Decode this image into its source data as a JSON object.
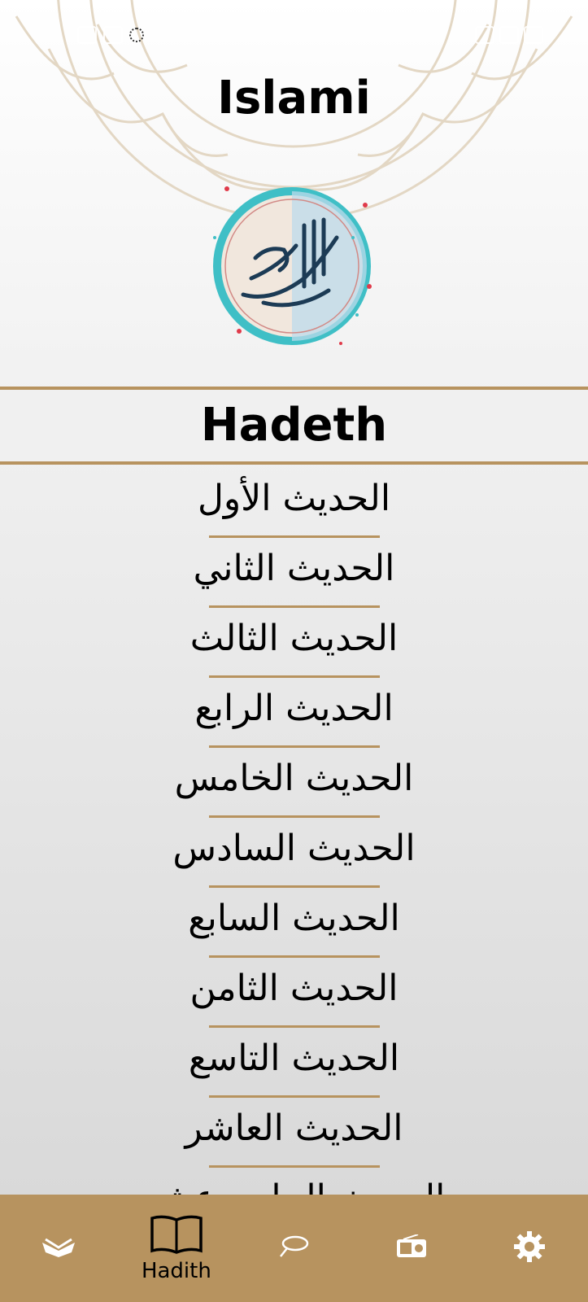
{
  "app": {
    "title": "Islami"
  },
  "section": {
    "title": "Hadeth"
  },
  "hadith_list": [
    "الحديث الأول",
    "الحديث الثاني",
    "الحديث الثالث",
    "الحديث الرابع",
    "الحديث الخامس",
    "الحديث السادس",
    "الحديث السابع",
    "الحديث الثامن",
    "الحديث التاسع",
    "الحديث العاشر",
    "الحديث الحادي عشر"
  ],
  "bottom_nav": {
    "items": [
      {
        "icon": "quran-icon",
        "label": ""
      },
      {
        "icon": "book-open-icon",
        "label": "Hadith",
        "active": true
      },
      {
        "icon": "sebha-icon",
        "label": ""
      },
      {
        "icon": "radio-icon",
        "label": ""
      },
      {
        "icon": "gear-icon",
        "label": ""
      }
    ]
  },
  "colors": {
    "accent": "#b7935f",
    "text": "#000000"
  }
}
